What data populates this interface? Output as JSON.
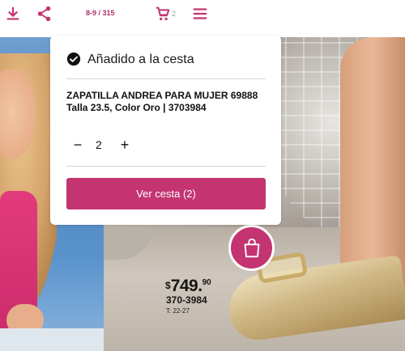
{
  "toolbar": {
    "download_icon": "download-icon",
    "share_icon": "share-icon",
    "page_counter": "8-9 / 315",
    "cart_icon": "cart-icon",
    "cart_count": "2",
    "menu_icon": "menu-icon"
  },
  "popup": {
    "title": "Añadido a la cesta",
    "product_name": "ZAPATILLA ANDREA PARA MUJER 69888 Talla 23.5, Color Oro | 3703984",
    "quantity_minus": "−",
    "quantity": "2",
    "quantity_plus": "+",
    "button_label": "Ver cesta (2)"
  },
  "catalog": {
    "price_symbol": "$",
    "price_whole": "749.",
    "price_cents": "90",
    "product_code": "370-3984",
    "size_range": "T: 22-27"
  },
  "colors": {
    "brand": "#c33470",
    "counter": "#b0306a"
  }
}
